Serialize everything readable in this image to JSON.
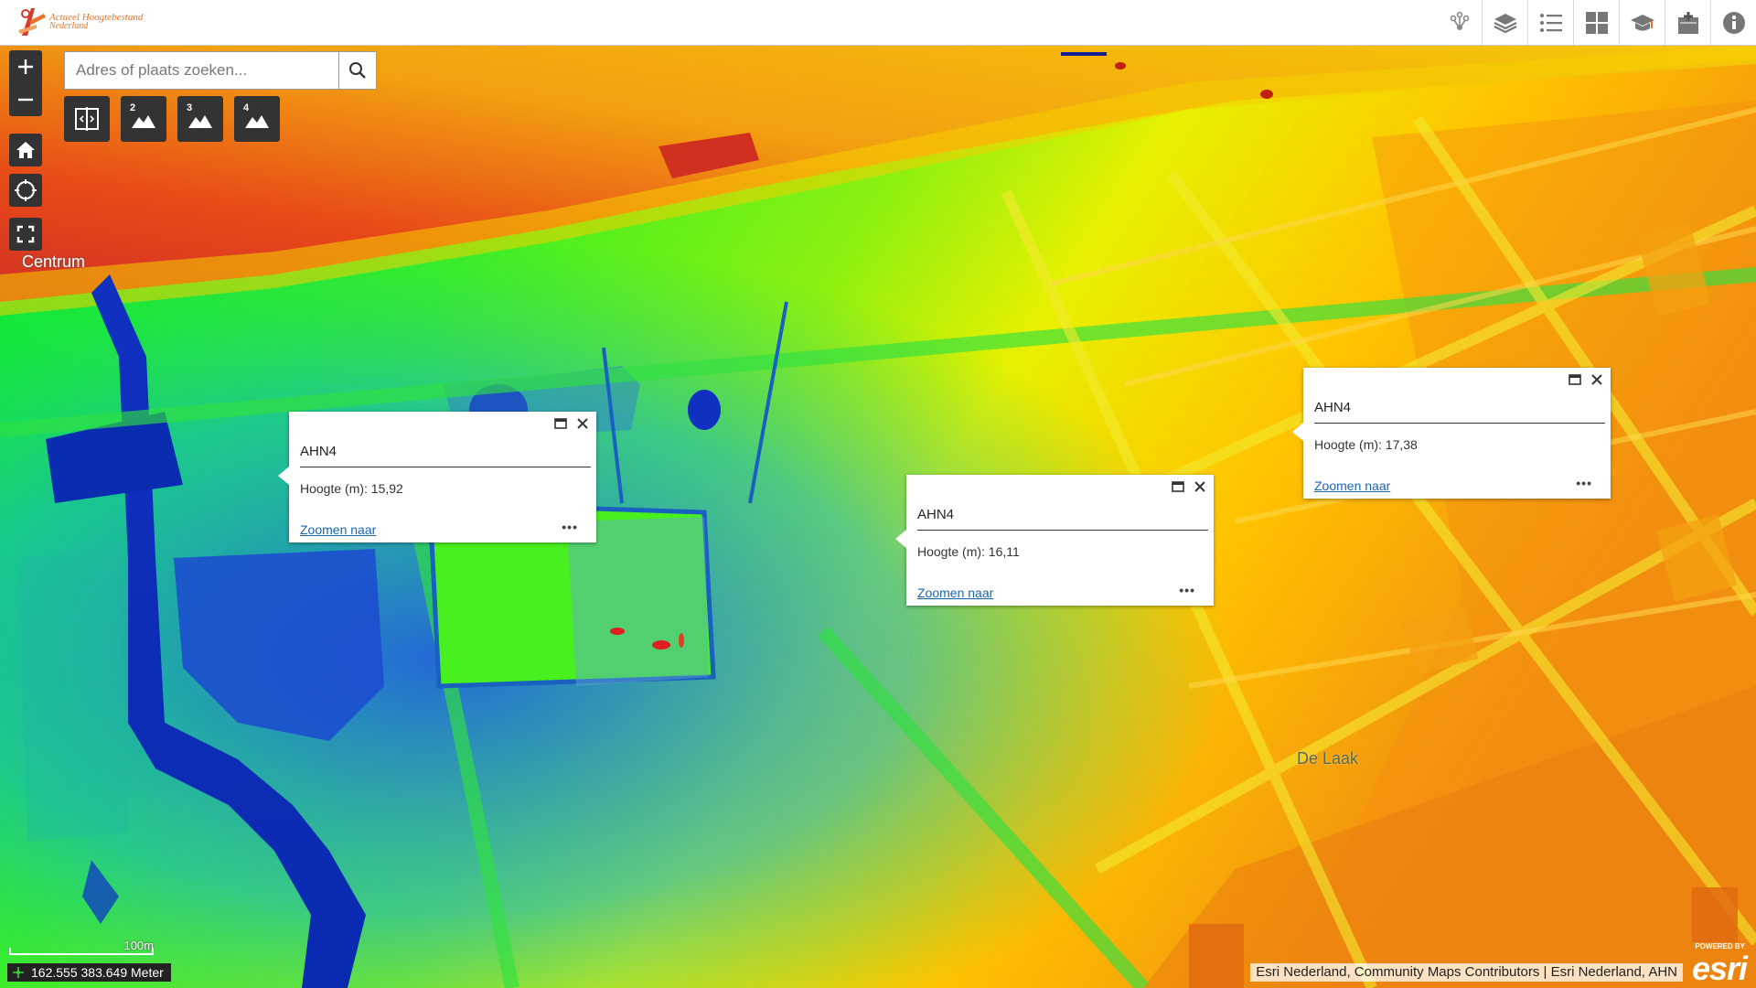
{
  "header": {
    "logo_line1": "Actueel Hoogtebestand",
    "logo_line2": "Nederland",
    "tools": [
      {
        "icon": "share-icon"
      },
      {
        "icon": "layers-icon"
      },
      {
        "icon": "legend-icon"
      },
      {
        "icon": "basemap-gallery-icon"
      },
      {
        "icon": "graduation-cap-icon"
      },
      {
        "icon": "bookmark-add-icon"
      },
      {
        "icon": "info-icon"
      }
    ]
  },
  "search": {
    "placeholder": "Adres of plaats zoeken..."
  },
  "map": {
    "place_labels": {
      "centrum": "Centrum",
      "de_laak": "De Laak"
    },
    "widgets": [
      {
        "num": ""
      },
      {
        "num": "2"
      },
      {
        "num": "3"
      },
      {
        "num": "4"
      }
    ],
    "popups": [
      {
        "title": "AHN4",
        "body": "Hoogte (m): 15,92",
        "link": "Zoomen naar",
        "more": "•••"
      },
      {
        "title": "AHN4",
        "body": "Hoogte (m): 16,11",
        "link": "Zoomen naar",
        "more": "•••"
      },
      {
        "title": "AHN4",
        "body": "Hoogte (m): 17,38",
        "link": "Zoomen naar",
        "more": "•••"
      }
    ]
  },
  "footer": {
    "scale_label": "100m",
    "coordinates": "162.555 383.649 Meter",
    "attribution": "Esri Nederland, Community Maps Contributors | Esri Nederland, AHN",
    "esri_powered": "POWERED BY",
    "esri_wordmark": "esri"
  },
  "colors": {
    "accent": "#e8732a",
    "control_bg": "#333333",
    "link": "#1a65b0"
  }
}
